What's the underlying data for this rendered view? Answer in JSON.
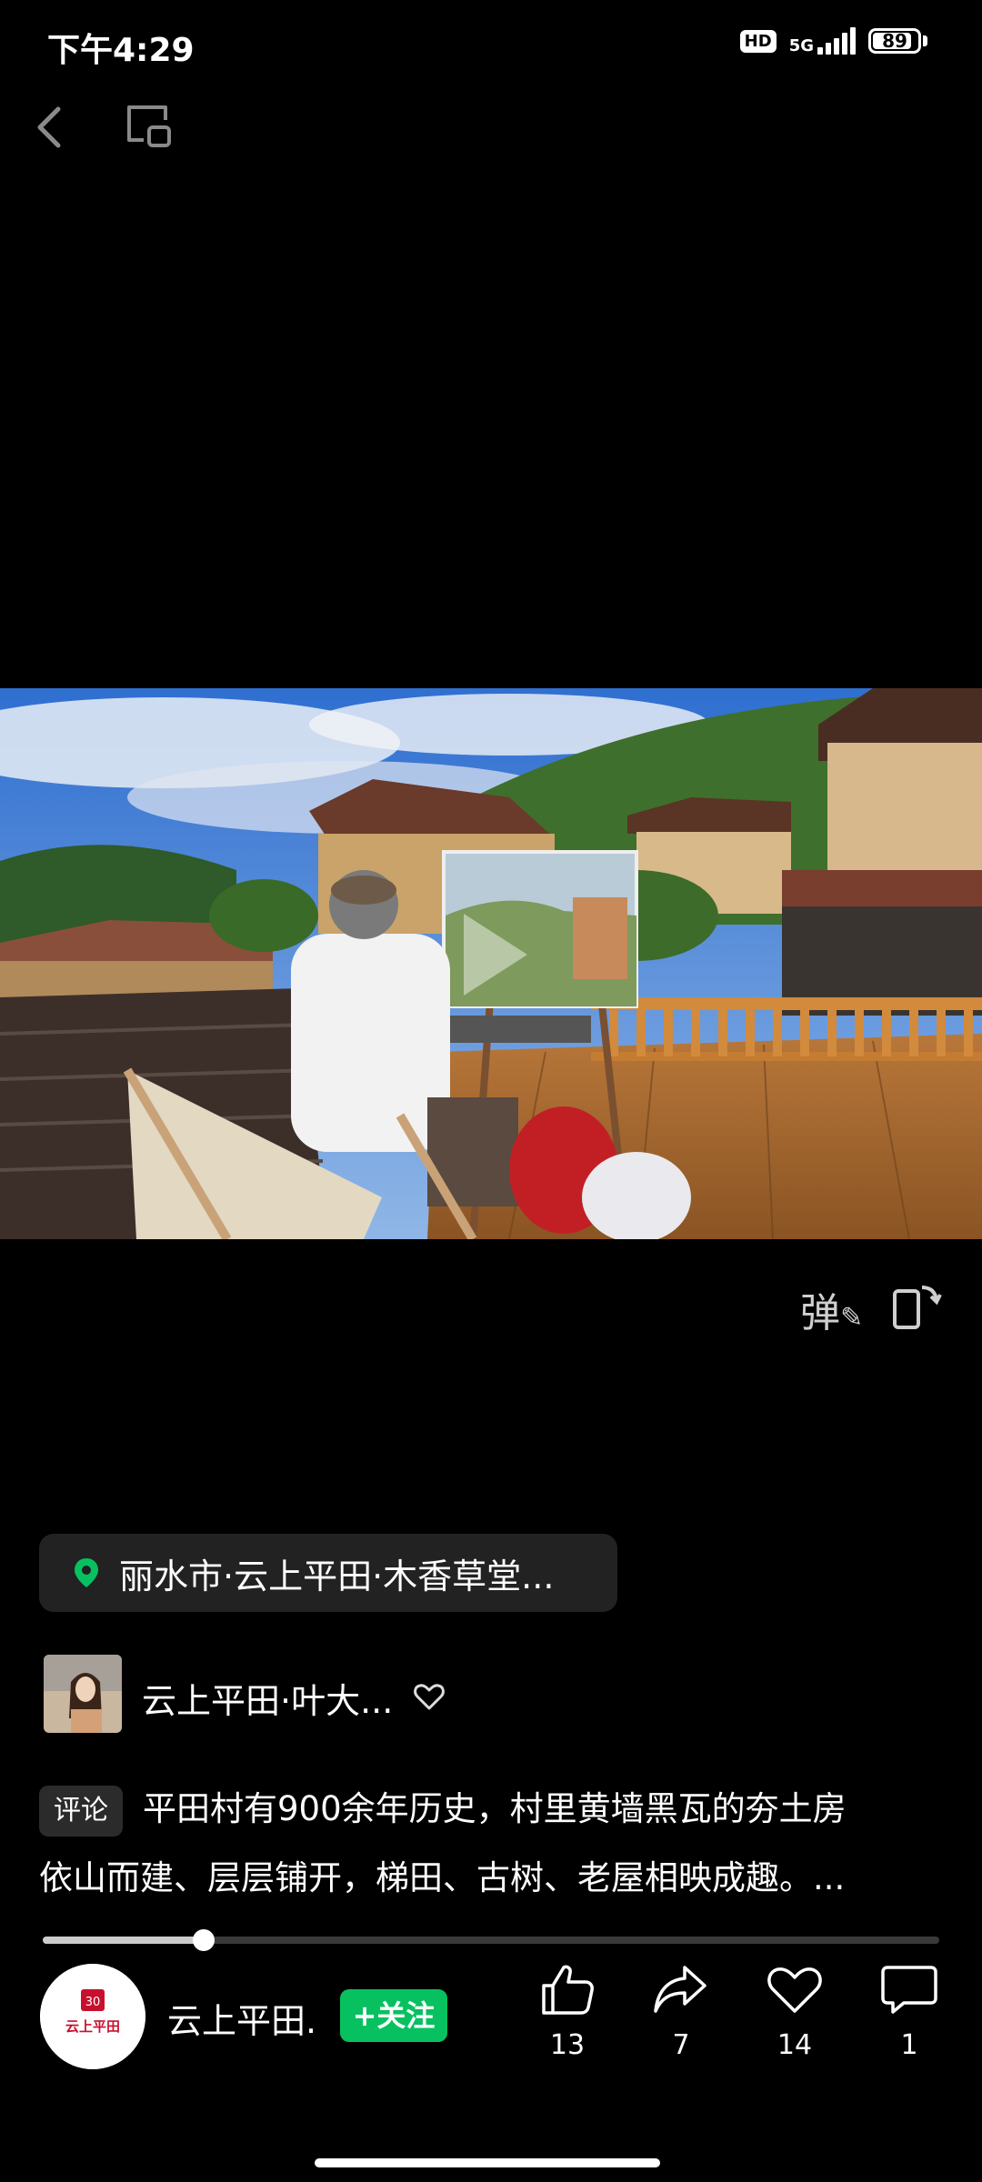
{
  "status_bar": {
    "time": "下午4:29",
    "hd_label": "HD",
    "network": "5G",
    "battery": "89"
  },
  "video": {
    "danmaku_label": "弹"
  },
  "location": {
    "text": "丽水市·云上平田·木香草堂..."
  },
  "author": {
    "name": "云上平田·叶大..."
  },
  "caption": {
    "tag": "评论",
    "line1": "平田村有900余年历史，村里黄墙黑瓦的夯土房",
    "line2": "依山而建、层层铺开，梯田、古树、老屋相映成趣。..."
  },
  "progress": {
    "fraction": 0.18
  },
  "channel": {
    "name": "云上平田.",
    "follow_label": "+关注",
    "logo_text": "云上平田"
  },
  "actions": {
    "like_count": "13",
    "share_count": "7",
    "favorite_count": "14",
    "comment_count": "1"
  }
}
